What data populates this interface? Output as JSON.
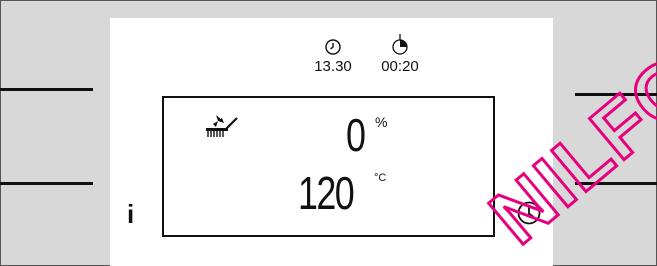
{
  "header": {
    "clock_time": "13.30",
    "duration_time": "00:20"
  },
  "display": {
    "mode_icon": "fan-brush-icon",
    "percent_value": "0",
    "percent_unit": "%",
    "temperature_value": "120",
    "temperature_unit": "°C"
  },
  "controls": {
    "info_label": "i",
    "timer_icon": "clock-icon"
  },
  "watermark": {
    "text": "NILFO"
  },
  "colors": {
    "background": "#d8d8d8",
    "panel": "#ffffff",
    "ink": "#111111",
    "watermark": "#e6007e"
  }
}
